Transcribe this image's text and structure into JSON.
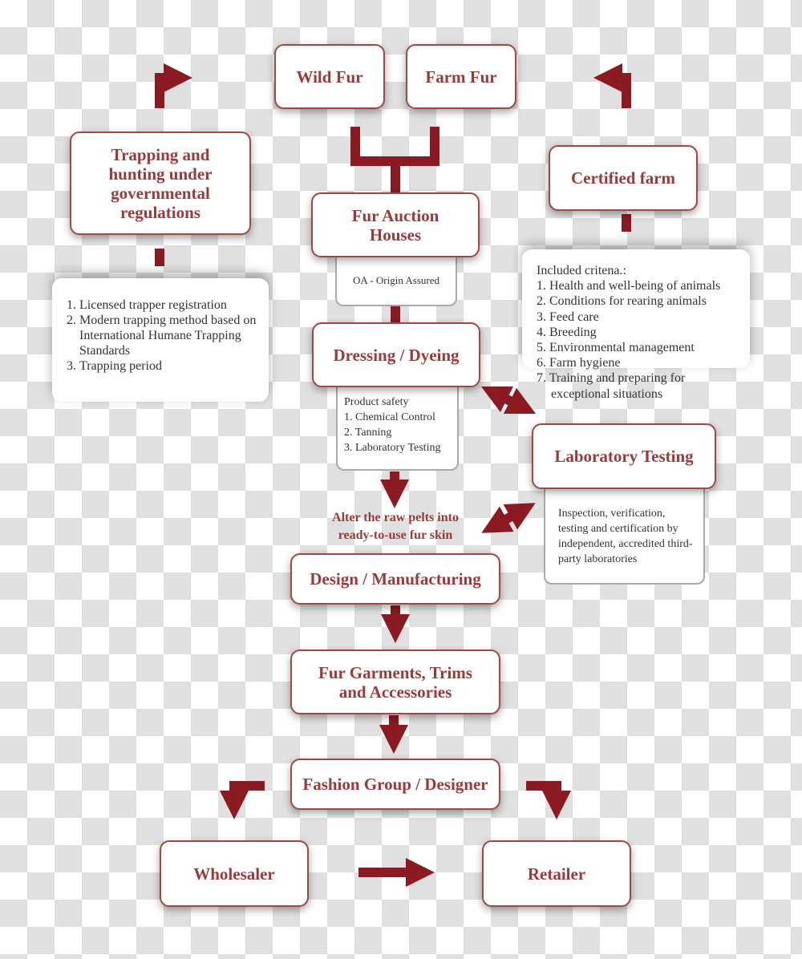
{
  "colors": {
    "accent": "#8b1a22",
    "box_text": "#9b3a3a",
    "box_border": "#a04848"
  },
  "nodes": {
    "wild_fur": "Wild Fur",
    "farm_fur": "Farm Fur",
    "trapping": "Trapping and hunting under governmental regulations",
    "certified_farm": "Certified farm",
    "auction": "Fur Auction Houses",
    "oa": "OA - Origin Assured",
    "dressing": "Dressing / Dyeing",
    "lab_testing": "Laboratory Testing",
    "lab_desc": "Inspection, verification, testing and certification by independent, accredited third-party laboratories",
    "alter": "Alter the raw pelts into ready-to-use fur skin",
    "design": "Design / Manufacturing",
    "garments": "Fur Garments, Trims and Accessories",
    "fashion": "Fashion Group / Designer",
    "wholesaler": "Wholesaler",
    "retailer": "Retailer"
  },
  "product_safety": {
    "title": "Product safety",
    "items": [
      "1. Chemical Control",
      "2. Tanning",
      "3. Laboratory Testing"
    ]
  },
  "trapping_list": [
    "Licensed trapper registration",
    "Modern trapping method based on International Humane Trapping Standards",
    "Trapping period"
  ],
  "criteria": {
    "title": "Included critena.:",
    "items": [
      "1. Health and well-being of animals",
      "2. Conditions for rearing animals",
      "3. Feed care",
      "4. Breeding",
      "5. Environmental management",
      "6. Farm hygiene",
      "7. Training and preparing for exceptional situations"
    ]
  }
}
